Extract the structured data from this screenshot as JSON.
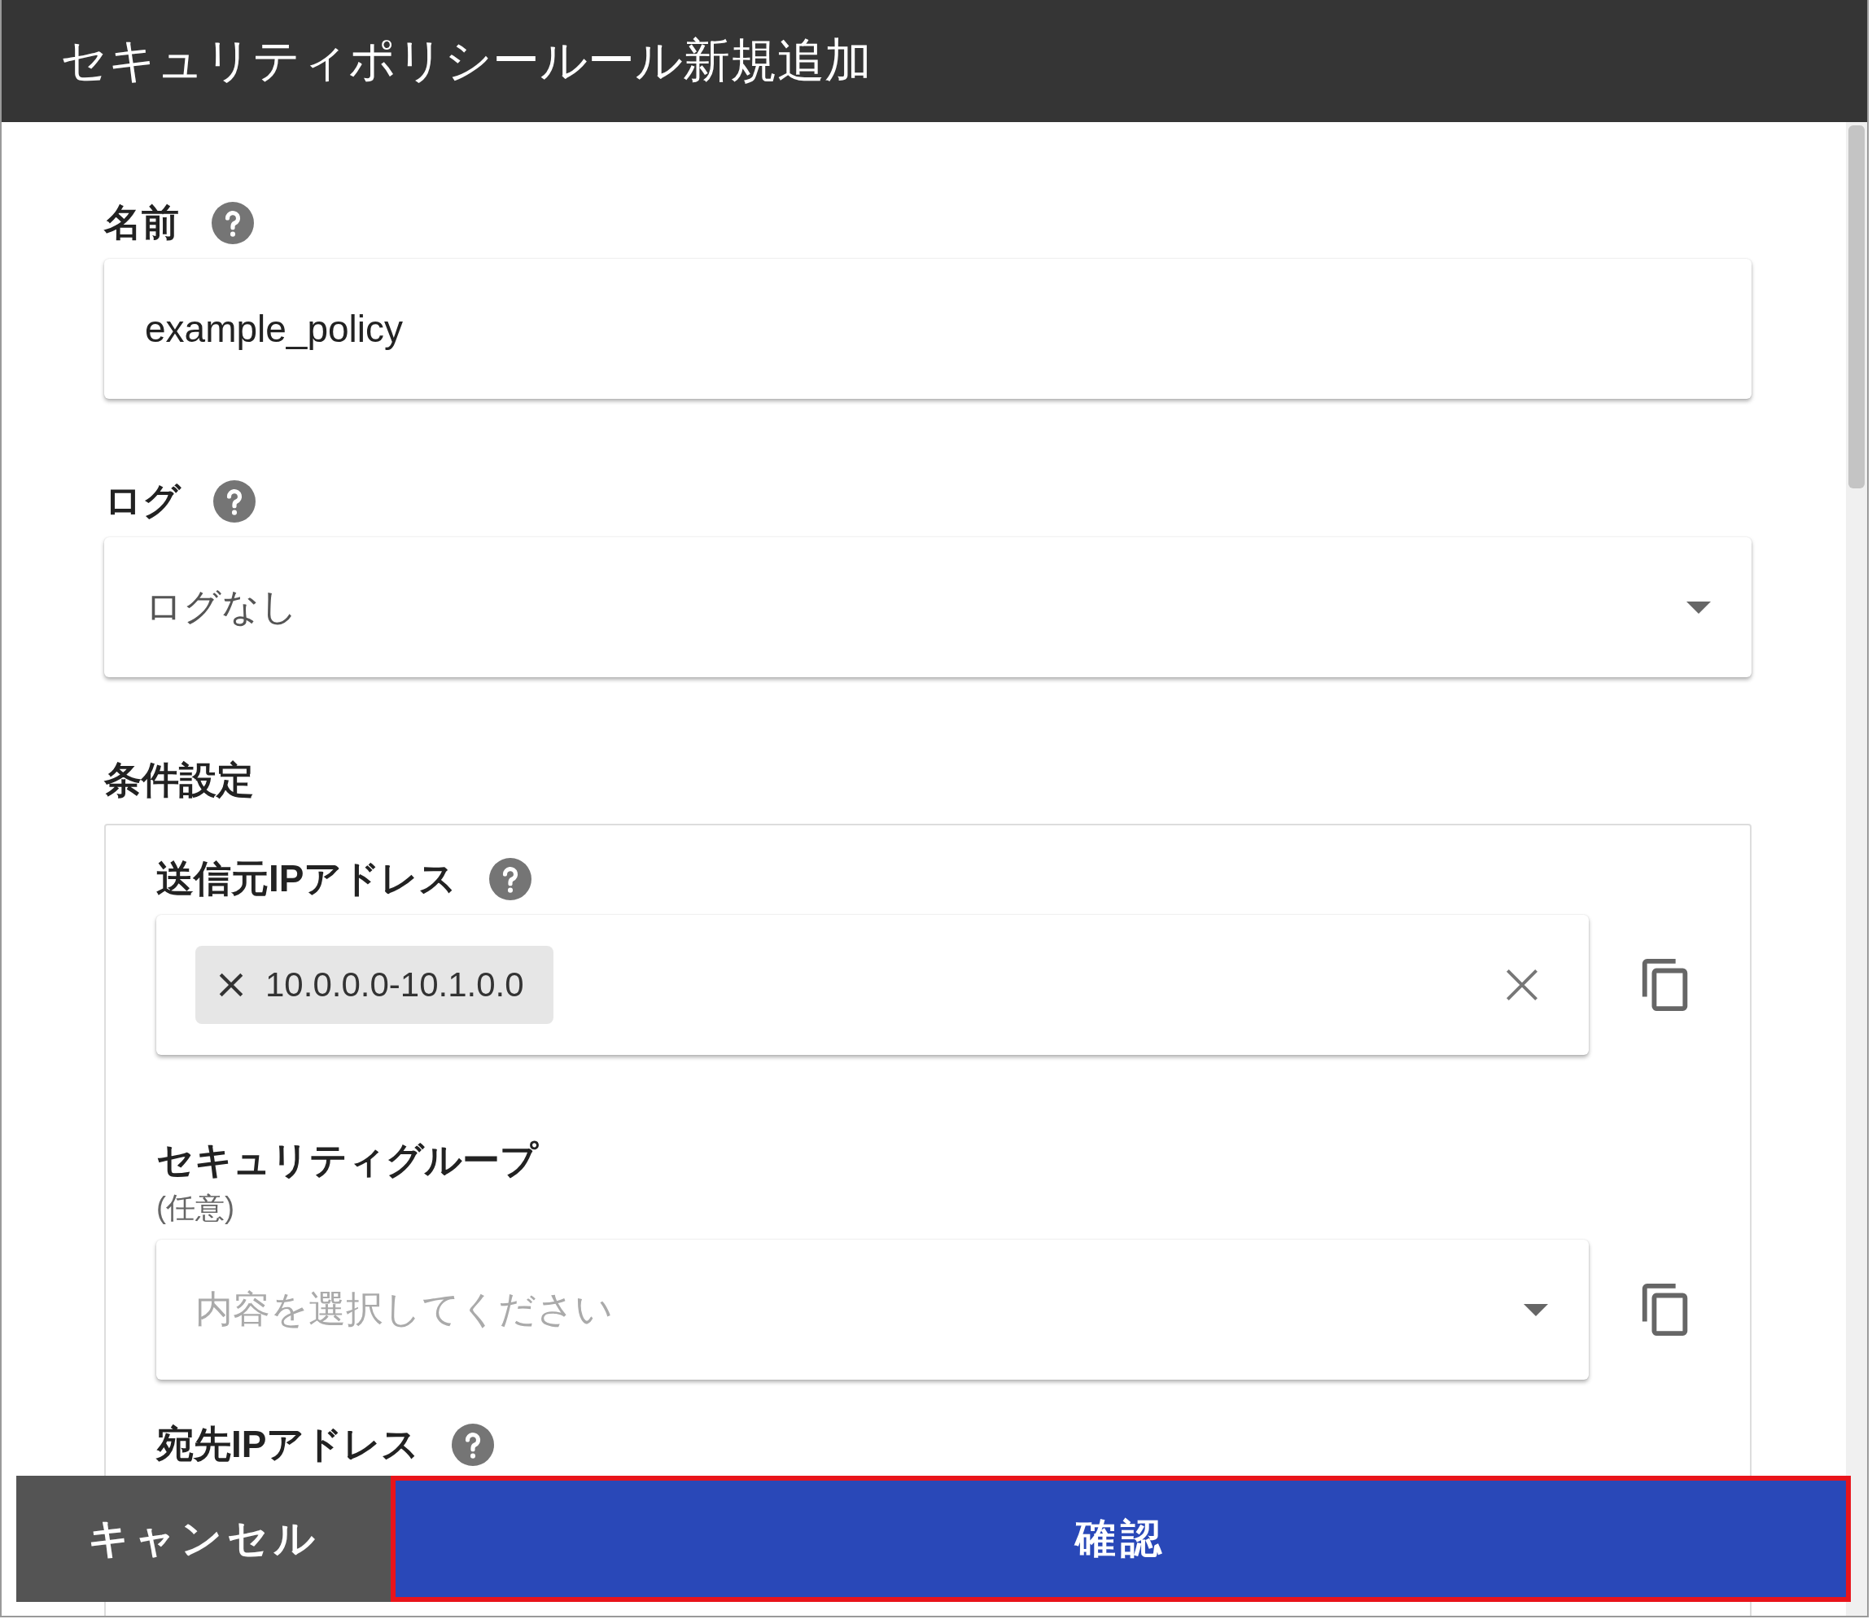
{
  "window": {
    "title": "セキュリティポリシールール新規追加"
  },
  "fields": [
    {
      "kind": "text",
      "label": "名前",
      "help": true,
      "value": "example_policy"
    },
    {
      "kind": "select",
      "label": "ログ",
      "help": true,
      "value": "ログなし"
    }
  ],
  "conditions": {
    "title": "条件設定",
    "items": [
      {
        "kind": "chips",
        "label": "送信元IPアドレス",
        "help": true,
        "copy": true,
        "chips": [
          "10.0.0.0-10.1.0.0"
        ]
      },
      {
        "kind": "select",
        "label": "セキュリティグループ",
        "help": false,
        "copy": true,
        "note": "(任意)",
        "placeholder": "内容を選択してください"
      },
      {
        "kind": "label",
        "label": "宛先IPアドレス",
        "help": true,
        "copy": false
      }
    ]
  },
  "buttons": [
    {
      "kind": "cancel",
      "label": "キャンセル",
      "highlighted": false
    },
    {
      "kind": "primary",
      "label": "確認",
      "highlighted": true
    }
  ]
}
